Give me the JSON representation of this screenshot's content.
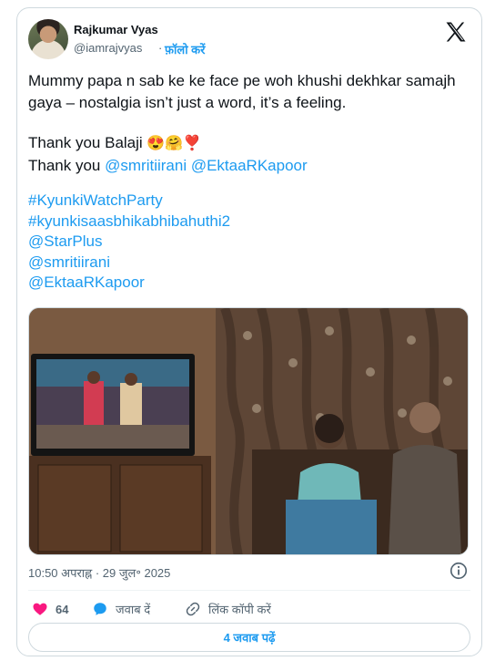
{
  "author": {
    "name": "Rajkumar Vyas",
    "handle": "@iamrajvyas",
    "separator": "·",
    "follow_label": "फ़ॉलो करें"
  },
  "post": {
    "line1": "Mummy papa n sab ke ke face pe woh khushi dekhkar samajh gaya – nostalgia isn’t just a word, it’s a feeling.",
    "thanks_prefix": "Thank you Balaji ",
    "thanks_emojis": "😍🤗❣️",
    "thanks2_prefix": "Thank you ",
    "mention1": "@smritiirani",
    "mention2": "@EktaaRKapoor",
    "tags": [
      "#KyunkiWatchParty",
      "#kyunkisaasbhikabhibahuthi2",
      "@StarPlus",
      "@smritiirani",
      "@EktaaRKapoor"
    ]
  },
  "meta": {
    "timestamp": "10:50 अपराह्न · 29 जुल॰ 2025"
  },
  "actions": {
    "like_count": "64",
    "reply_label": "जवाब दें",
    "copy_link_label": "लिंक कॉपी करें"
  },
  "replies_button": "4 जवाब पढ़ें",
  "colors": {
    "accent": "#1d9bf0",
    "like": "#f91880",
    "text": "#0f1419",
    "muted": "#536471"
  },
  "icons": [
    "x-logo-icon",
    "info-icon",
    "heart-icon",
    "reply-bubble-icon",
    "link-icon"
  ]
}
